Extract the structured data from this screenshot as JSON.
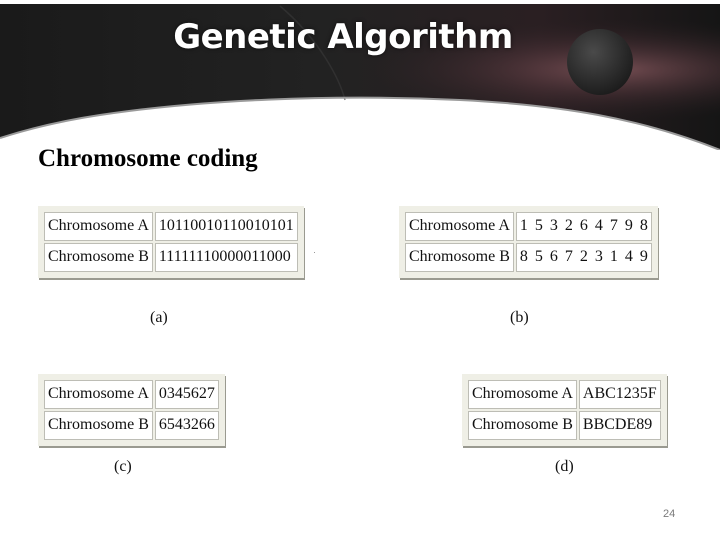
{
  "slide": {
    "title": "Genetic Algorithm",
    "subtitle": "Chromosome coding",
    "page_number": "24"
  },
  "figures": [
    {
      "caption": "(a)",
      "rows": [
        {
          "label": "Chromosome A",
          "value": "1011001011001010​1"
        },
        {
          "label": "Chromosome B",
          "value": "1111111000001100​0"
        }
      ]
    },
    {
      "caption": "(b)",
      "rows": [
        {
          "label": "Chromosome A",
          "value": "1 5 3 2 6 4 7 9 8"
        },
        {
          "label": "Chromosome B",
          "value": "8 5 6 7 2 3 1 4 9"
        }
      ]
    },
    {
      "caption": "(c)",
      "rows": [
        {
          "label": "Chromosome A",
          "value": "0345627"
        },
        {
          "label": "Chromosome B",
          "value": "6543266"
        }
      ]
    },
    {
      "caption": "(d)",
      "rows": [
        {
          "label": "Chromosome A",
          "value": "ABC1235F"
        },
        {
          "label": "Chromosome B",
          "value": "BBCDE89"
        }
      ]
    }
  ]
}
